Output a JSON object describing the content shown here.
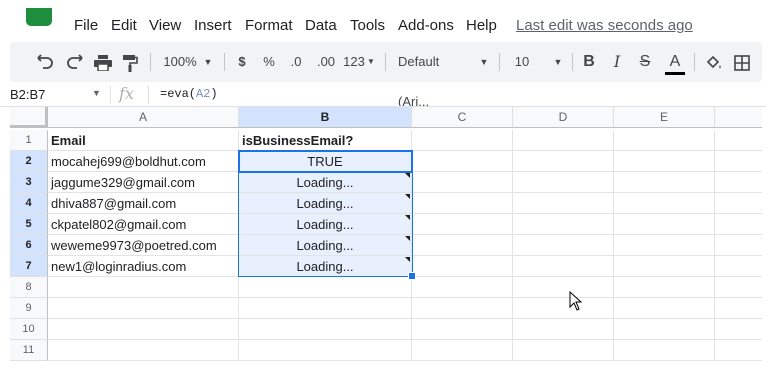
{
  "menubar": {
    "items": [
      "File",
      "Edit",
      "View",
      "Insert",
      "Format",
      "Data",
      "Tools",
      "Add-ons",
      "Help"
    ],
    "last_edit": "Last edit was seconds ago"
  },
  "toolbar": {
    "zoom": "100%",
    "currency": "$",
    "percent": "%",
    "decrease_decimal": ".0",
    "increase_decimal": ".00",
    "more_formats": "123",
    "font": "Default (Ari...",
    "font_size": "10",
    "bold": "B",
    "italic": "I",
    "strikethrough": "S",
    "text_color": "A"
  },
  "formula_bar": {
    "name_box": "B2:B7",
    "fx": "fx",
    "formula_prefix": "=eva(",
    "formula_ref": "A2",
    "formula_suffix": ")"
  },
  "sheet": {
    "columns": [
      "A",
      "B",
      "C",
      "D",
      "E"
    ],
    "rows": [
      "1",
      "2",
      "3",
      "4",
      "5",
      "6",
      "7",
      "8",
      "9",
      "10",
      "11"
    ],
    "header": [
      "Email",
      "isBusinessEmail?"
    ],
    "data": [
      [
        "mocahej699@boldhut.com",
        "TRUE"
      ],
      [
        "jaggume329@gmail.com",
        "Loading..."
      ],
      [
        "dhiva887@gmail.com",
        "Loading..."
      ],
      [
        "ckpatel802@gmail.com",
        "Loading..."
      ],
      [
        "weweme9973@poetred.com",
        "Loading..."
      ],
      [
        "new1@loginradius.com",
        "Loading..."
      ]
    ],
    "selected_range": "B2:B7"
  },
  "colors": {
    "selection": "#1a73e8",
    "selection_fill": "#e8f0fe",
    "header_selected": "#d3e3fd",
    "logo": "#1e8e3e"
  }
}
